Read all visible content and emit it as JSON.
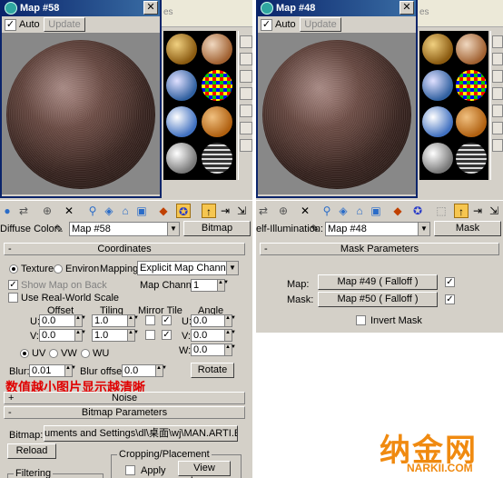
{
  "left": {
    "window_title": "Map #58",
    "behind_title_fragment": "es",
    "auto_label": "Auto",
    "auto_checked": "✓",
    "update_label": "Update",
    "property_label": "Diffuse Color:",
    "map_name": "Map #58",
    "map_type_button": "Bitmap",
    "coordinates": {
      "sign": "-",
      "title": "Coordinates",
      "texture_label": "Texture",
      "environ_label": "Environ",
      "mapping_label": "Mapping:",
      "mapping_value": "Explicit Map Channel",
      "show_map_on_back": "Show Map on Back",
      "map_channel_label": "Map Channel:",
      "map_channel_value": "1",
      "real_world_scale": "Use Real-World Scale",
      "offset_label": "Offset",
      "tiling_label": "Tiling",
      "mirror_tile_label": "Mirror Tile",
      "angle_label": "Angle",
      "u_label": "U:",
      "v_label": "V:",
      "w_label": "W:",
      "u_offset": "0.0",
      "v_offset": "0.0",
      "u_tiling": "1.0",
      "v_tiling": "1.0",
      "u_angle": "0.0",
      "v_angle": "0.0",
      "w_angle": "0.0",
      "tile_checked": "✓",
      "uv_label": "UV",
      "vw_label": "VW",
      "wu_label": "WU",
      "blur_label": "Blur:",
      "blur_value": "0.01",
      "blur_offset_label": "Blur offset:",
      "blur_offset_value": "0.0",
      "rotate_label": "Rotate"
    },
    "note": "数值越小图片显示越清晰",
    "noise": {
      "sign": "+",
      "title": "Noise"
    },
    "bitmap_params": {
      "sign": "-",
      "title": "Bitmap Parameters",
      "bitmap_label": "Bitmap:",
      "bitmap_path": "uments and Settings\\dl\\桌面\\wj\\MAN.ARTI.EMGL.JPG",
      "reload_label": "Reload",
      "cropping_title": "Cropping/Placement",
      "apply_label": "Apply",
      "view_image_label": "View Image",
      "filtering_title": "Filtering"
    }
  },
  "right": {
    "window_title": "Map #48",
    "auto_label": "Auto",
    "auto_checked": "✓",
    "update_label": "Update",
    "property_label": "elf-Illumination:",
    "map_name": "Map #48",
    "map_type_button": "Mask",
    "mask_params": {
      "sign": "-",
      "title": "Mask Parameters",
      "map_label": "Map:",
      "map_button": "Map #49  ( Falloff )",
      "mask_label": "Mask:",
      "mask_button": "Map #50  ( Falloff )",
      "map_checked": "✓",
      "mask_checked": "✓",
      "invert_label": "Invert Mask"
    }
  },
  "watermark": {
    "logo": "纳金网",
    "url": "NARKII.COM"
  },
  "colors": {
    "titlebar": "#0a246a",
    "face": "#d4d0c8",
    "accent_note": "#e00000",
    "watermark": "#f08a10"
  }
}
